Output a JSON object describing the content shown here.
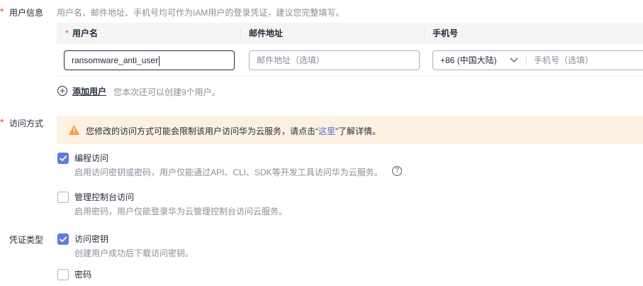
{
  "user_info": {
    "label": "用户信息",
    "description": "用户名、邮件地址、手机号均可作为IAM用户的登录凭证，建议您完整填写。",
    "columns": {
      "username": "用户名",
      "email": "邮件地址",
      "phone": "手机号"
    },
    "row": {
      "username_value": "ransomware_anti_user",
      "email_placeholder": "邮件地址（选填）",
      "phone_country": "+86 (中国大陆)",
      "phone_placeholder": "手机号（选填）"
    },
    "add_user": {
      "label": "添加用户",
      "hint": "您本次还可以创建9个用户。"
    }
  },
  "access_mode": {
    "label": "访问方式",
    "warning": {
      "prefix": "您修改的访问方式可能会限制该用户访问华为云服务，请点击“",
      "link": "这里",
      "suffix": "”了解详情。"
    },
    "options": [
      {
        "label": "编程访问",
        "description": "启用访问密钥或密码，用户仅能通过API、CLI、SDK等开发工具访问华为云服务。",
        "checked": true
      },
      {
        "label": "管理控制台访问",
        "description": "启用密码，用户仅能登录华为云管理控制台访问云服务。",
        "checked": false
      }
    ]
  },
  "credential_type": {
    "label": "凭证类型",
    "options": [
      {
        "label": "访问密钥",
        "description": "创建用户成功后下载访问密钥。",
        "checked": true
      },
      {
        "label": "密码",
        "checked": false
      }
    ]
  },
  "colors": {
    "required": "#e54545",
    "checkbox_on": "#5e7ce0",
    "warning_bg": "#fdf1e4",
    "warning_icon": "#fa9841",
    "link": "#526ecc"
  },
  "icons": [
    "warning-icon",
    "help-icon",
    "chevron-down-icon",
    "add-circle-icon",
    "check-icon"
  ]
}
